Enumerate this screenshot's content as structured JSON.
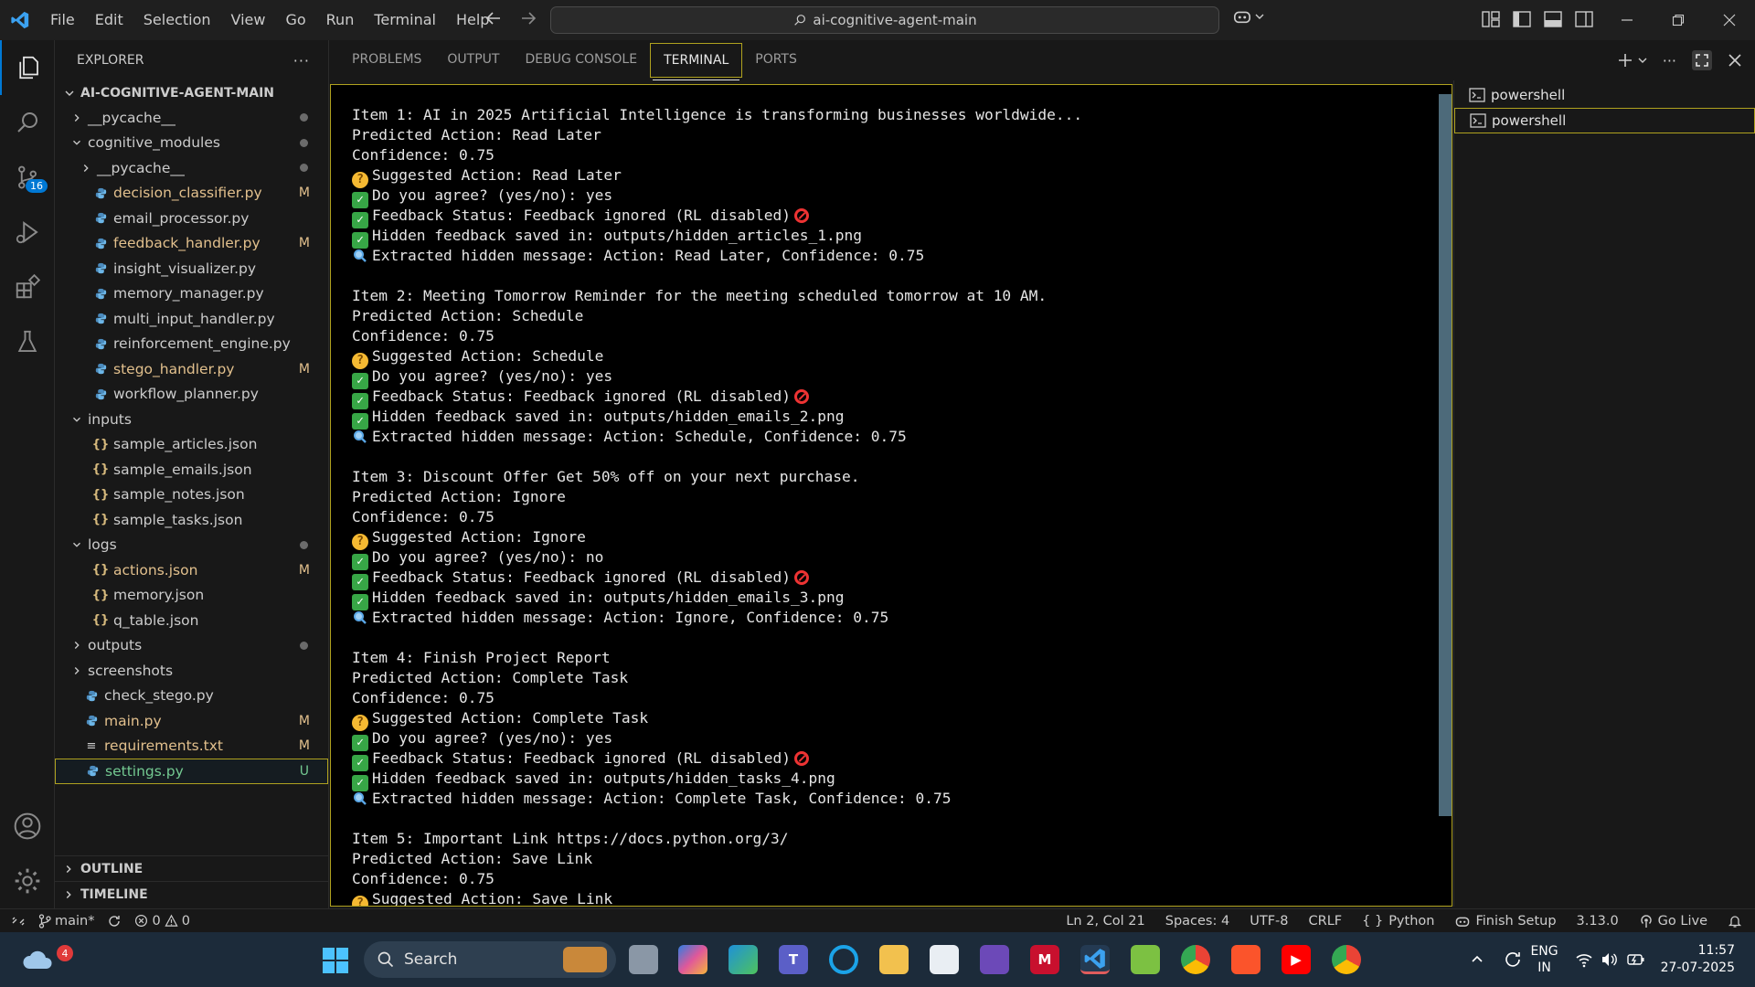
{
  "titlebar": {
    "menu": [
      "File",
      "Edit",
      "Selection",
      "View",
      "Go",
      "Run",
      "Terminal",
      "Help"
    ],
    "search": "ai-cognitive-agent-main"
  },
  "activity": {
    "scm_badge": "16"
  },
  "explorer": {
    "title": "EXPLORER",
    "more": "···",
    "root": "AI-COGNITIVE-AGENT-MAIN",
    "items": [
      {
        "name": "__pycache__",
        "kind": "dir",
        "depth": 1,
        "open": false,
        "status": "",
        "dot": true
      },
      {
        "name": "cognitive_modules",
        "kind": "dir",
        "depth": 1,
        "open": true,
        "status": "",
        "dot": true
      },
      {
        "name": "__pycache__",
        "kind": "dir",
        "depth": 2,
        "open": false,
        "status": "",
        "dot": true
      },
      {
        "name": "decision_classifier.py",
        "kind": "py",
        "depth": 2,
        "status": "M"
      },
      {
        "name": "email_processor.py",
        "kind": "py",
        "depth": 2,
        "status": ""
      },
      {
        "name": "feedback_handler.py",
        "kind": "py",
        "depth": 2,
        "status": "M"
      },
      {
        "name": "insight_visualizer.py",
        "kind": "py",
        "depth": 2,
        "status": ""
      },
      {
        "name": "memory_manager.py",
        "kind": "py",
        "depth": 2,
        "status": ""
      },
      {
        "name": "multi_input_handler.py",
        "kind": "py",
        "depth": 2,
        "status": ""
      },
      {
        "name": "reinforcement_engine.py",
        "kind": "py",
        "depth": 2,
        "status": ""
      },
      {
        "name": "stego_handler.py",
        "kind": "py",
        "depth": 2,
        "status": "M"
      },
      {
        "name": "workflow_planner.py",
        "kind": "py",
        "depth": 2,
        "status": ""
      },
      {
        "name": "inputs",
        "kind": "dir",
        "depth": 1,
        "open": true,
        "status": "",
        "dot": false
      },
      {
        "name": "sample_articles.json",
        "kind": "json",
        "depth": 2,
        "status": ""
      },
      {
        "name": "sample_emails.json",
        "kind": "json",
        "depth": 2,
        "status": ""
      },
      {
        "name": "sample_notes.json",
        "kind": "json",
        "depth": 2,
        "status": ""
      },
      {
        "name": "sample_tasks.json",
        "kind": "json",
        "depth": 2,
        "status": ""
      },
      {
        "name": "logs",
        "kind": "dir",
        "depth": 1,
        "open": true,
        "status": "",
        "dot": true
      },
      {
        "name": "actions.json",
        "kind": "json",
        "depth": 2,
        "status": "M"
      },
      {
        "name": "memory.json",
        "kind": "json",
        "depth": 2,
        "status": ""
      },
      {
        "name": "q_table.json",
        "kind": "json",
        "depth": 2,
        "status": ""
      },
      {
        "name": "outputs",
        "kind": "dir",
        "depth": 1,
        "open": false,
        "status": "",
        "dot": true
      },
      {
        "name": "screenshots",
        "kind": "dir",
        "depth": 1,
        "open": false,
        "status": "",
        "dot": false
      },
      {
        "name": "check_stego.py",
        "kind": "py",
        "depth": 1,
        "status": ""
      },
      {
        "name": "main.py",
        "kind": "py",
        "depth": 1,
        "status": "M"
      },
      {
        "name": "requirements.txt",
        "kind": "txt",
        "depth": 1,
        "status": "M"
      },
      {
        "name": "settings.py",
        "kind": "py",
        "depth": 1,
        "status": "U",
        "selected": true
      }
    ],
    "outline": "OUTLINE",
    "timeline": "TIMELINE"
  },
  "panel": {
    "tabs": [
      "PROBLEMS",
      "OUTPUT",
      "DEBUG CONSOLE",
      "TERMINAL",
      "PORTS"
    ],
    "active_tab": "TERMINAL"
  },
  "terminal": {
    "lines": [
      {
        "icon": "",
        "text": "Item 1: AI in 2025 Artificial Intelligence is transforming businesses worldwide...",
        "no": false
      },
      {
        "icon": "",
        "text": "Predicted Action: Read Later",
        "no": false
      },
      {
        "icon": "",
        "text": "Confidence: 0.75",
        "no": false
      },
      {
        "icon": "think",
        "text": "Suggested Action: Read Later",
        "no": false
      },
      {
        "icon": "check",
        "text": "Do you agree? (yes/no): yes",
        "no": false
      },
      {
        "icon": "check",
        "text": "Feedback Status: Feedback ignored (RL disabled)",
        "no": true
      },
      {
        "icon": "check",
        "text": "Hidden feedback saved in: outputs/hidden_articles_1.png",
        "no": false
      },
      {
        "icon": "search",
        "text": "Extracted hidden message: Action: Read Later, Confidence: 0.75",
        "no": false
      },
      {
        "icon": "",
        "text": "",
        "no": false
      },
      {
        "icon": "",
        "text": "Item 2: Meeting Tomorrow Reminder for the meeting scheduled tomorrow at 10 AM.",
        "no": false
      },
      {
        "icon": "",
        "text": "Predicted Action: Schedule",
        "no": false
      },
      {
        "icon": "",
        "text": "Confidence: 0.75",
        "no": false
      },
      {
        "icon": "think",
        "text": "Suggested Action: Schedule",
        "no": false
      },
      {
        "icon": "check",
        "text": "Do you agree? (yes/no): yes",
        "no": false
      },
      {
        "icon": "check",
        "text": "Feedback Status: Feedback ignored (RL disabled)",
        "no": true
      },
      {
        "icon": "check",
        "text": "Hidden feedback saved in: outputs/hidden_emails_2.png",
        "no": false
      },
      {
        "icon": "search",
        "text": "Extracted hidden message: Action: Schedule, Confidence: 0.75",
        "no": false
      },
      {
        "icon": "",
        "text": "",
        "no": false
      },
      {
        "icon": "",
        "text": "Item 3: Discount Offer Get 50% off on your next purchase.",
        "no": false
      },
      {
        "icon": "",
        "text": "Predicted Action: Ignore",
        "no": false
      },
      {
        "icon": "",
        "text": "Confidence: 0.75",
        "no": false
      },
      {
        "icon": "think",
        "text": "Suggested Action: Ignore",
        "no": false
      },
      {
        "icon": "check",
        "text": "Do you agree? (yes/no): no",
        "no": false
      },
      {
        "icon": "check",
        "text": "Feedback Status: Feedback ignored (RL disabled)",
        "no": true
      },
      {
        "icon": "check",
        "text": "Hidden feedback saved in: outputs/hidden_emails_3.png",
        "no": false
      },
      {
        "icon": "search",
        "text": "Extracted hidden message: Action: Ignore, Confidence: 0.75",
        "no": false
      },
      {
        "icon": "",
        "text": "",
        "no": false
      },
      {
        "icon": "",
        "text": "Item 4: Finish Project Report",
        "no": false
      },
      {
        "icon": "",
        "text": "Predicted Action: Complete Task",
        "no": false
      },
      {
        "icon": "",
        "text": "Confidence: 0.75",
        "no": false
      },
      {
        "icon": "think",
        "text": "Suggested Action: Complete Task",
        "no": false
      },
      {
        "icon": "check",
        "text": "Do you agree? (yes/no): yes",
        "no": false
      },
      {
        "icon": "check",
        "text": "Feedback Status: Feedback ignored (RL disabled)",
        "no": true
      },
      {
        "icon": "check",
        "text": "Hidden feedback saved in: outputs/hidden_tasks_4.png",
        "no": false
      },
      {
        "icon": "search",
        "text": "Extracted hidden message: Action: Complete Task, Confidence: 0.75",
        "no": false
      },
      {
        "icon": "",
        "text": "",
        "no": false
      },
      {
        "icon": "",
        "text": "Item 5: Important Link https://docs.python.org/3/",
        "no": false
      },
      {
        "icon": "",
        "text": "Predicted Action: Save Link",
        "no": false
      },
      {
        "icon": "",
        "text": "Confidence: 0.75",
        "no": false
      },
      {
        "icon": "think",
        "text": "Suggested Action: Save Link",
        "no": false
      }
    ]
  },
  "terminal_list": [
    "powershell",
    "powershell"
  ],
  "statusbar": {
    "branch": "main*",
    "errors": "0",
    "warnings": "0",
    "position": "Ln 2, Col 21",
    "spaces": "Spaces: 4",
    "encoding": "UTF-8",
    "eol": "CRLF",
    "language": "Python",
    "finish_setup": "Finish Setup",
    "version": "3.13.0",
    "golive": "Go Live"
  },
  "taskbar": {
    "weather_badge": "4",
    "search": "Search",
    "lang1": "ENG",
    "lang2": "IN",
    "time": "11:57",
    "date": "27-07-2025"
  },
  "colors": {
    "accent": "#0078d4",
    "modified": "#e2c08d",
    "untracked": "#73c991",
    "focus_border": "#b0a21f"
  }
}
